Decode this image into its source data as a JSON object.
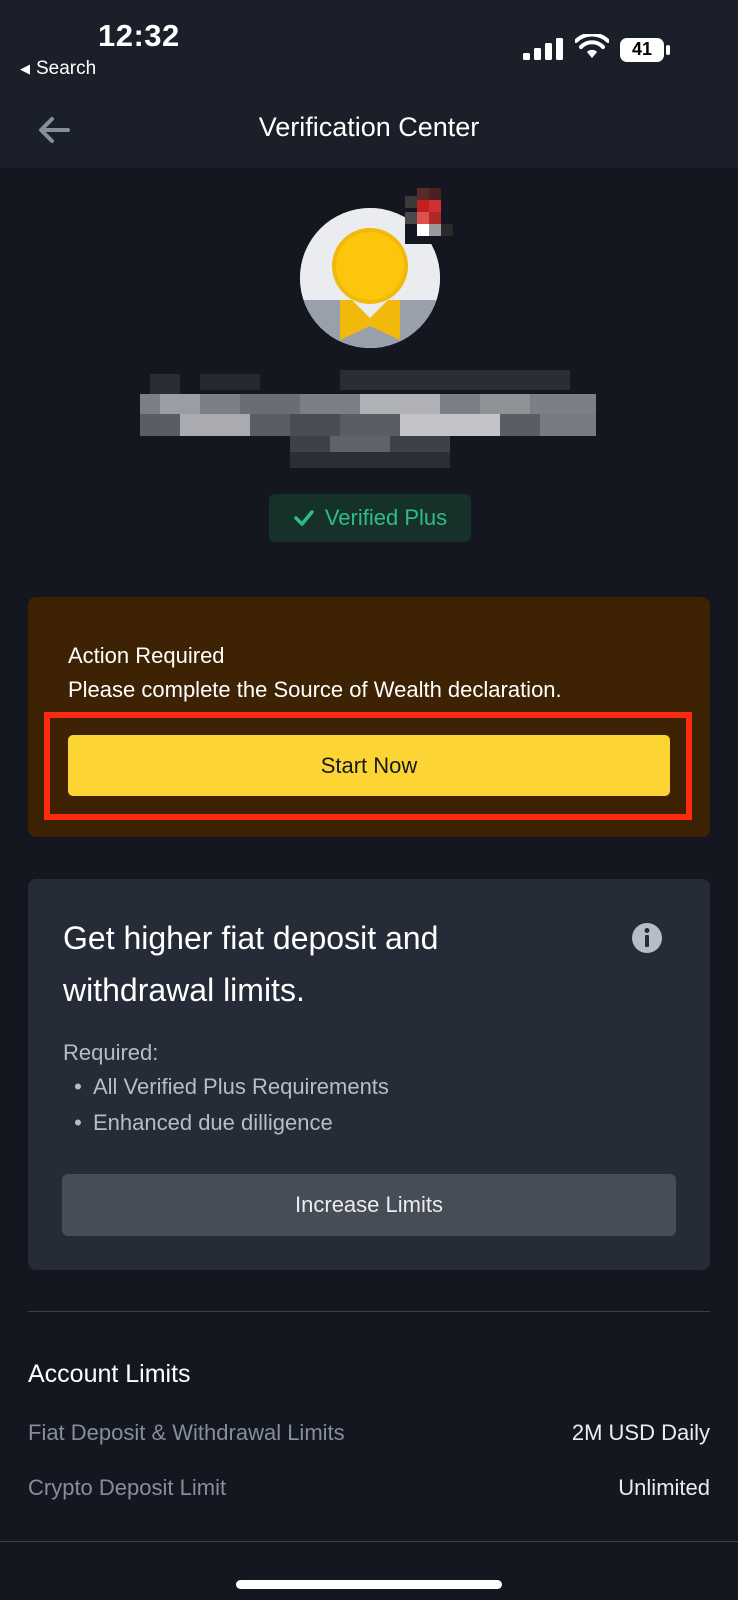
{
  "status_bar": {
    "time": "12:32",
    "back_label": "Search",
    "battery": "41"
  },
  "header": {
    "title": "Verification Center"
  },
  "profile": {
    "badge_label": "Verified Plus"
  },
  "action_card": {
    "title": "Action Required",
    "description": "Please complete the Source of Wealth declaration.",
    "button_label": "Start Now"
  },
  "limits_card": {
    "title": "Get higher fiat deposit and withdrawal limits.",
    "required_label": "Required:",
    "requirements": [
      "All Verified Plus Requirements",
      "Enhanced due dilligence"
    ],
    "button_label": "Increase Limits"
  },
  "account_limits": {
    "title": "Account Limits",
    "rows": [
      {
        "label": "Fiat Deposit & Withdrawal Limits",
        "value": "2M USD Daily"
      },
      {
        "label": "Crypto Deposit Limit",
        "value": "Unlimited"
      }
    ]
  },
  "colors": {
    "background": "#141720",
    "accent_yellow": "#FCD535",
    "success_green": "#2EBD85",
    "warning_card": "#3d2304",
    "highlight_red": "#ff2a12"
  },
  "icons": [
    "back-arrow-icon",
    "signal-icon",
    "wifi-icon",
    "battery-icon",
    "avatar-icon",
    "checkmark-icon",
    "info-icon"
  ]
}
